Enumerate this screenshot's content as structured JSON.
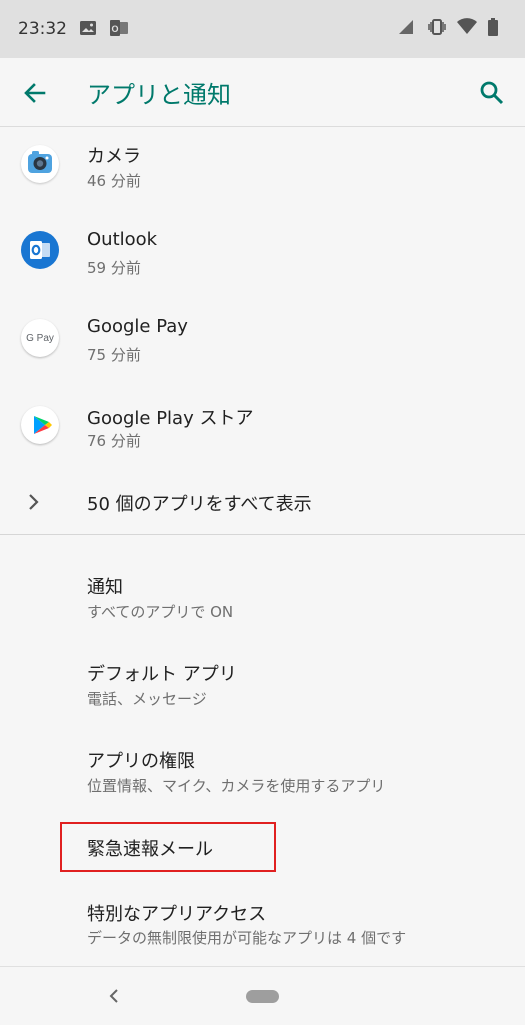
{
  "status_bar": {
    "time": "23:32"
  },
  "app_bar": {
    "title": "アプリと通知"
  },
  "recent_apps": [
    {
      "name": "カメラ",
      "time": "46 分前",
      "icon": "camera-app-icon"
    },
    {
      "name": "Outlook",
      "time": "59 分前",
      "icon": "outlook-app-icon"
    },
    {
      "name": "Google Pay",
      "time": "75 分前",
      "icon": "google-pay-app-icon",
      "icon_text": "G Pay"
    },
    {
      "name": "Google Play ストア",
      "time": "76 分前",
      "icon": "google-play-store-app-icon"
    }
  ],
  "see_all": {
    "label": "50 個のアプリをすべて表示"
  },
  "settings": [
    {
      "title": "通知",
      "subtitle": "すべてのアプリで ON"
    },
    {
      "title": "デフォルト アプリ",
      "subtitle": "電話、メッセージ"
    },
    {
      "title": "アプリの権限",
      "subtitle": "位置情報、マイク、カメラを使用するアプリ"
    },
    {
      "title": "緊急速報メール",
      "subtitle": ""
    },
    {
      "title": "特別なアプリアクセス",
      "subtitle": "データの無制限使用が可能なアプリは 4 個です"
    }
  ],
  "colors": {
    "accent": "#00796b",
    "highlight": "#e02020"
  }
}
